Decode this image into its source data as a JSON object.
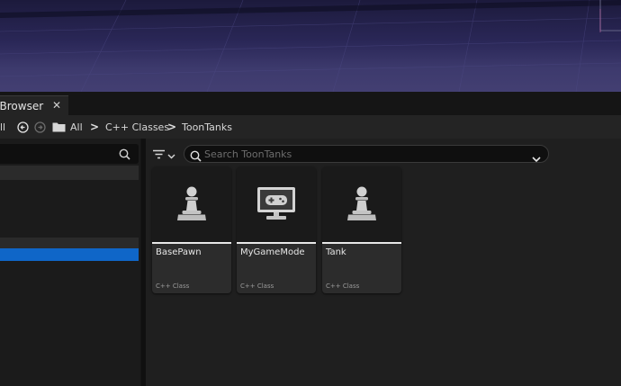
{
  "tab": {
    "title": "t Browser",
    "close_glyph": "✕"
  },
  "nav": {
    "partial_left_label": "ll",
    "back_icon": "circle-arrow-left-icon",
    "forward_icon": "circle-arrow-right-icon",
    "folder_icon": "folder-icon",
    "breadcrumbs": [
      {
        "label": "All"
      },
      {
        "label": "C++ Classes"
      },
      {
        "label": "ToonTanks"
      }
    ],
    "separator": ">"
  },
  "left_panel": {
    "search_icon": "search-icon"
  },
  "content": {
    "filter_icon": "filter-icon",
    "search": {
      "placeholder": "Search ToonTanks",
      "value": ""
    },
    "assets": [
      {
        "name": "BasePawn",
        "type": "C++ Class",
        "icon": "pawn-icon"
      },
      {
        "name": "MyGameMode",
        "type": "C++ Class",
        "icon": "game-mode-icon"
      },
      {
        "name": "Tank",
        "type": "C++ Class",
        "icon": "pawn-icon"
      }
    ]
  },
  "colors": {
    "selection": "#0f66c8",
    "viewport_top": "#1c1a3c",
    "viewport_bottom": "#433f72"
  }
}
